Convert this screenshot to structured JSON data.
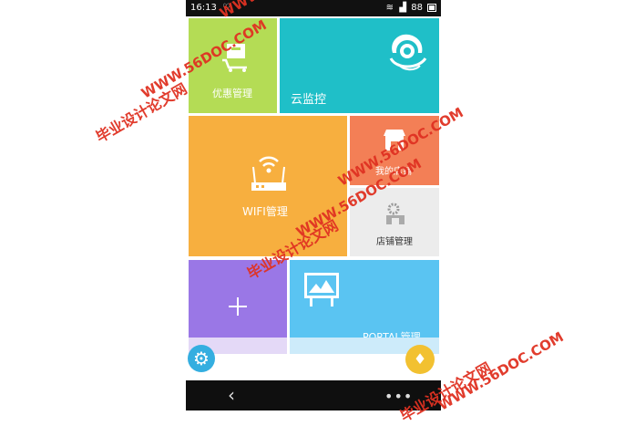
{
  "status_bar": {
    "time": "16:13",
    "battery": "88"
  },
  "tiles": {
    "promo": {
      "label": "优惠管理",
      "icon": "cart-icon",
      "color": "#b4dc55"
    },
    "cloud": {
      "label": "云监控",
      "icon": "camera-icon",
      "color": "#1fbfc8"
    },
    "wifi": {
      "label": "WIFI管理",
      "icon": "router-icon",
      "color": "#f7af3f"
    },
    "shop": {
      "label": "我的店铺",
      "icon": "store-icon",
      "color": "#f37f56"
    },
    "shop_mgr": {
      "label": "店铺管理",
      "icon": "gear-icon",
      "color": "#ececec"
    },
    "add": {
      "icon": "plus-icon",
      "color": "#9a77e6"
    },
    "portal": {
      "label": "PORTAL管理",
      "icon": "billboard-icon",
      "color": "#5ac4f2"
    }
  },
  "fabs": {
    "settings": {
      "icon": "settings-icon"
    },
    "gem": {
      "icon": "diamond-icon"
    }
  },
  "watermarks": [
    "毕业设计论文网",
    "WWW.56DOC.COM"
  ]
}
